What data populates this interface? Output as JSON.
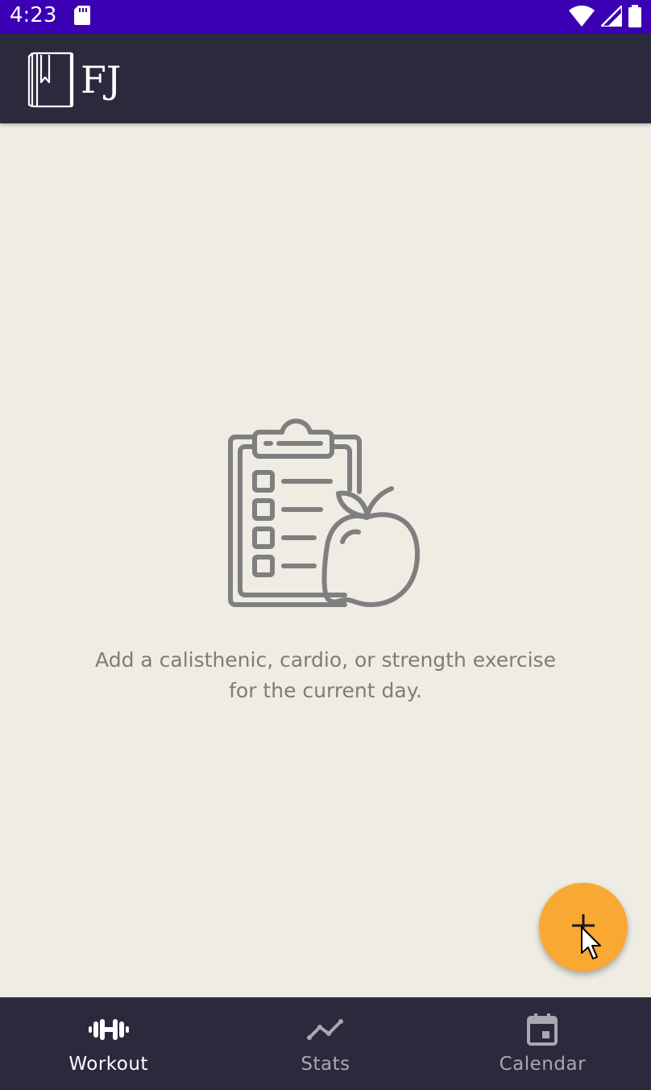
{
  "status_bar": {
    "time": "4:23",
    "icons": [
      "sd-card-icon",
      "wifi-icon",
      "signal-icon",
      "battery-icon"
    ]
  },
  "app_bar": {
    "logo_text": "FJ",
    "logo_icon": "bookmark-book-icon"
  },
  "empty_state": {
    "illustration": "clipboard-apple-icon",
    "message": "Add a calisthenic, cardio, or strength exercise for the current day."
  },
  "fab": {
    "icon": "plus-icon"
  },
  "bottom_nav": {
    "items": [
      {
        "label": "Workout",
        "icon": "dumbbell-icon",
        "active": true
      },
      {
        "label": "Stats",
        "icon": "trend-line-icon",
        "active": false
      },
      {
        "label": "Calendar",
        "icon": "calendar-icon",
        "active": false
      }
    ]
  },
  "colors": {
    "status_bar": "#3b00b4",
    "app_bar": "#2b2a3d",
    "background": "#efece4",
    "fab": "#f8a833",
    "text_muted": "#7e7c79",
    "nav_inactive": "#a9a8b0",
    "nav_active": "#ffffff"
  }
}
